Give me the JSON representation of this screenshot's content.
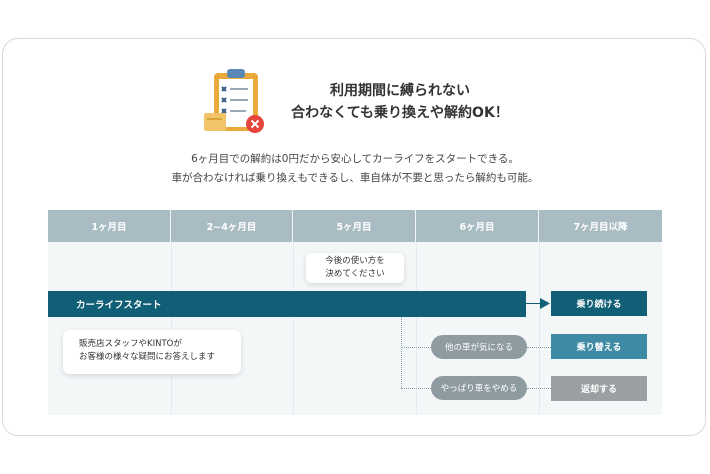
{
  "headline": {
    "line1": "利用期間に縛られない",
    "line2": "合わなくても乗り換えや解約OK！"
  },
  "subtext": {
    "line1": "6ヶ月目での解約は0円だから安心してカーライフをスタートできる。",
    "line2": "車が合わなければ乗り換えもできるし、車自体が不要と思ったら解約も可能。"
  },
  "timeline": {
    "columns": [
      "1ヶ月目",
      "2~4ヶ月目",
      "5ヶ月目",
      "6ヶ月目",
      "7ヶ月目以降"
    ],
    "main_bar": "カーライフスタート",
    "support_note": {
      "line1": "販売店スタッフやKINTOが",
      "line2": "お客様の様々な疑問にお答えします"
    },
    "month5_note": {
      "line1": "今後の使い方を",
      "line2": "決めてください"
    },
    "options": [
      {
        "pill": "",
        "result": "乗り続ける"
      },
      {
        "pill": "他の車が気になる",
        "result": "乗り替える"
      },
      {
        "pill": "やっぱり車をやめる",
        "result": "返却する"
      }
    ]
  },
  "colors": {
    "header": "#a9bcc3",
    "main_bar": "#115f76",
    "continue": "#115f76",
    "switch": "#3f8aa5",
    "return": "#9a9fa2",
    "pill": "#8e9ba1",
    "accent_red": "#e6453d"
  },
  "icons": [
    "clipboard-checklist-icon",
    "close-badge-icon",
    "arrow-right-icon"
  ]
}
